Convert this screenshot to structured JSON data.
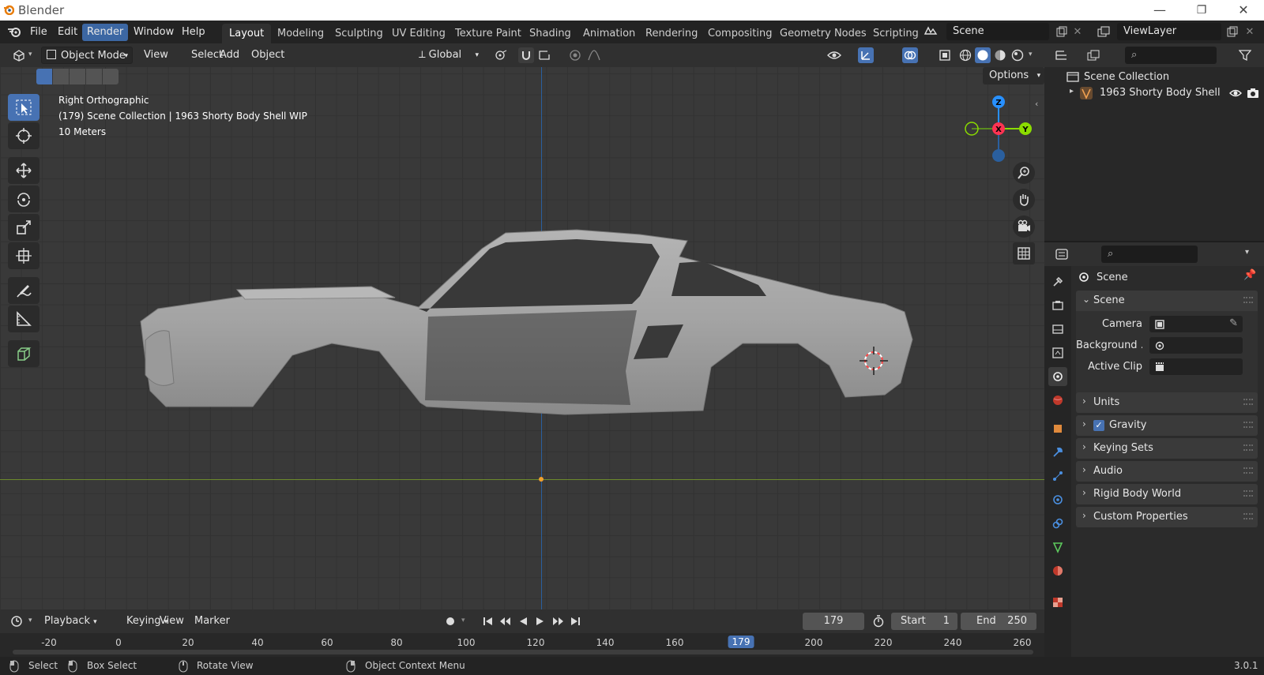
{
  "app": {
    "title": "Blender",
    "version": "3.0.1"
  },
  "window_controls": {
    "minimize": "—",
    "maximize": "❐",
    "close": "✕"
  },
  "menu": [
    "File",
    "Edit",
    "Render",
    "Window",
    "Help"
  ],
  "workspaces": [
    "Layout",
    "Modeling",
    "Sculpting",
    "UV Editing",
    "Texture Paint",
    "Shading",
    "Animation",
    "Rendering",
    "Compositing",
    "Geometry Nodes",
    "Scripting"
  ],
  "scene_name": "Scene",
  "view_layer": "ViewLayer",
  "viewport_header": {
    "mode": "Object Mode",
    "menus": [
      "View",
      "Select",
      "Add",
      "Object"
    ],
    "orientation": "Global",
    "options": "Options"
  },
  "viewport": {
    "view_name": "Right Orthographic",
    "collection_info": "(179) Scene Collection | 1963 Shorty Body Shell WIP",
    "scale": "10 Meters",
    "gizmo": {
      "z": "Z",
      "x": "X",
      "y": "Y"
    }
  },
  "outliner": {
    "root": "Scene Collection",
    "items": [
      "1963 Shorty Body Shell"
    ]
  },
  "properties": {
    "context": "Scene",
    "section": "Scene",
    "fields": [
      {
        "label": "Camera"
      },
      {
        "label": "Background ..."
      },
      {
        "label": "Active Clip"
      }
    ],
    "panels": [
      "Units",
      "Gravity",
      "Keying Sets",
      "Audio",
      "Rigid Body World",
      "Custom Properties"
    ],
    "gravity_enabled": true
  },
  "timeline": {
    "menus": [
      "Playback",
      "Keying",
      "View",
      "Marker"
    ],
    "current_frame": "179",
    "start_label": "Start",
    "start": "1",
    "end_label": "End",
    "end": "250",
    "ticks": [
      "-20",
      "0",
      "20",
      "40",
      "60",
      "80",
      "100",
      "120",
      "140",
      "160",
      "179",
      "200",
      "220",
      "240",
      "260"
    ]
  },
  "status": {
    "select": "Select",
    "box_select": "Box Select",
    "rotate_view": "Rotate View",
    "context_menu": "Object Context Menu"
  },
  "colors": {
    "accent": "#4772b3",
    "x_axis": "#ff3352",
    "y_axis": "#8bdc00",
    "z_axis": "#2890ff"
  }
}
